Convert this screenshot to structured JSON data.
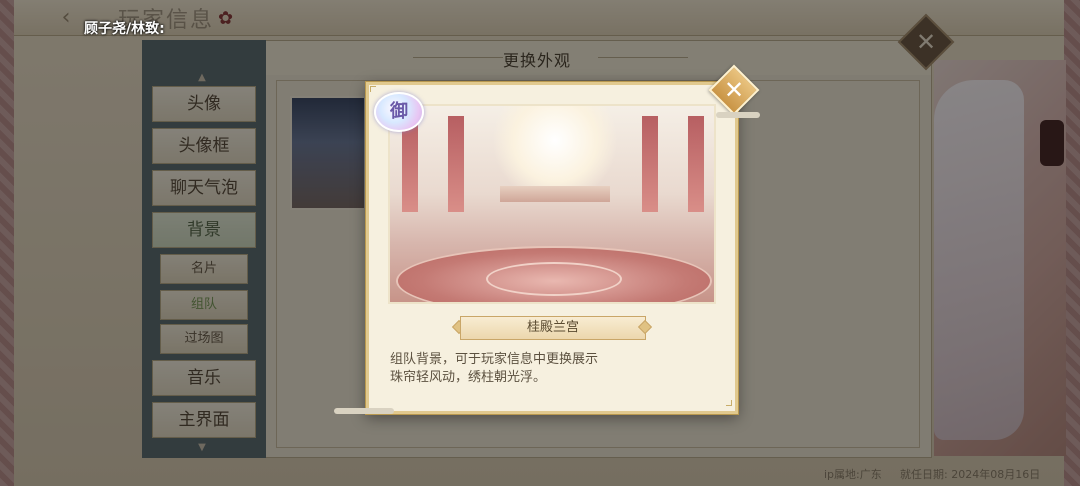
{
  "header": {
    "player_name": "顾子尧/林致:",
    "page_title": "玩家信息"
  },
  "panel": {
    "title": "更换外观"
  },
  "sidebar": {
    "items": [
      {
        "label": "头像"
      },
      {
        "label": "头像框"
      },
      {
        "label": "聊天气泡"
      },
      {
        "label": "背景"
      },
      {
        "label": "音乐"
      },
      {
        "label": "主界面"
      }
    ],
    "subitems": [
      {
        "label": "名片"
      },
      {
        "label": "组队"
      },
      {
        "label": "过场图"
      }
    ]
  },
  "modal": {
    "badge": "御",
    "item_name": "桂殿兰宫",
    "description_line1": "组队背景，可于玩家信息中更换展示",
    "description_line2": "珠帘轻风动，绣柱朝光浮。"
  },
  "footer": {
    "ip_location": "ip属地:广东",
    "appointment_date": "就任日期: 2024年08月16日"
  },
  "icons": {
    "back": "chevron-left-icon",
    "close": "close-icon"
  },
  "colors": {
    "accent_gold": "#c99445",
    "sidebar_bg": "#5e6d72",
    "active_subitem": "#7a9a5a"
  }
}
